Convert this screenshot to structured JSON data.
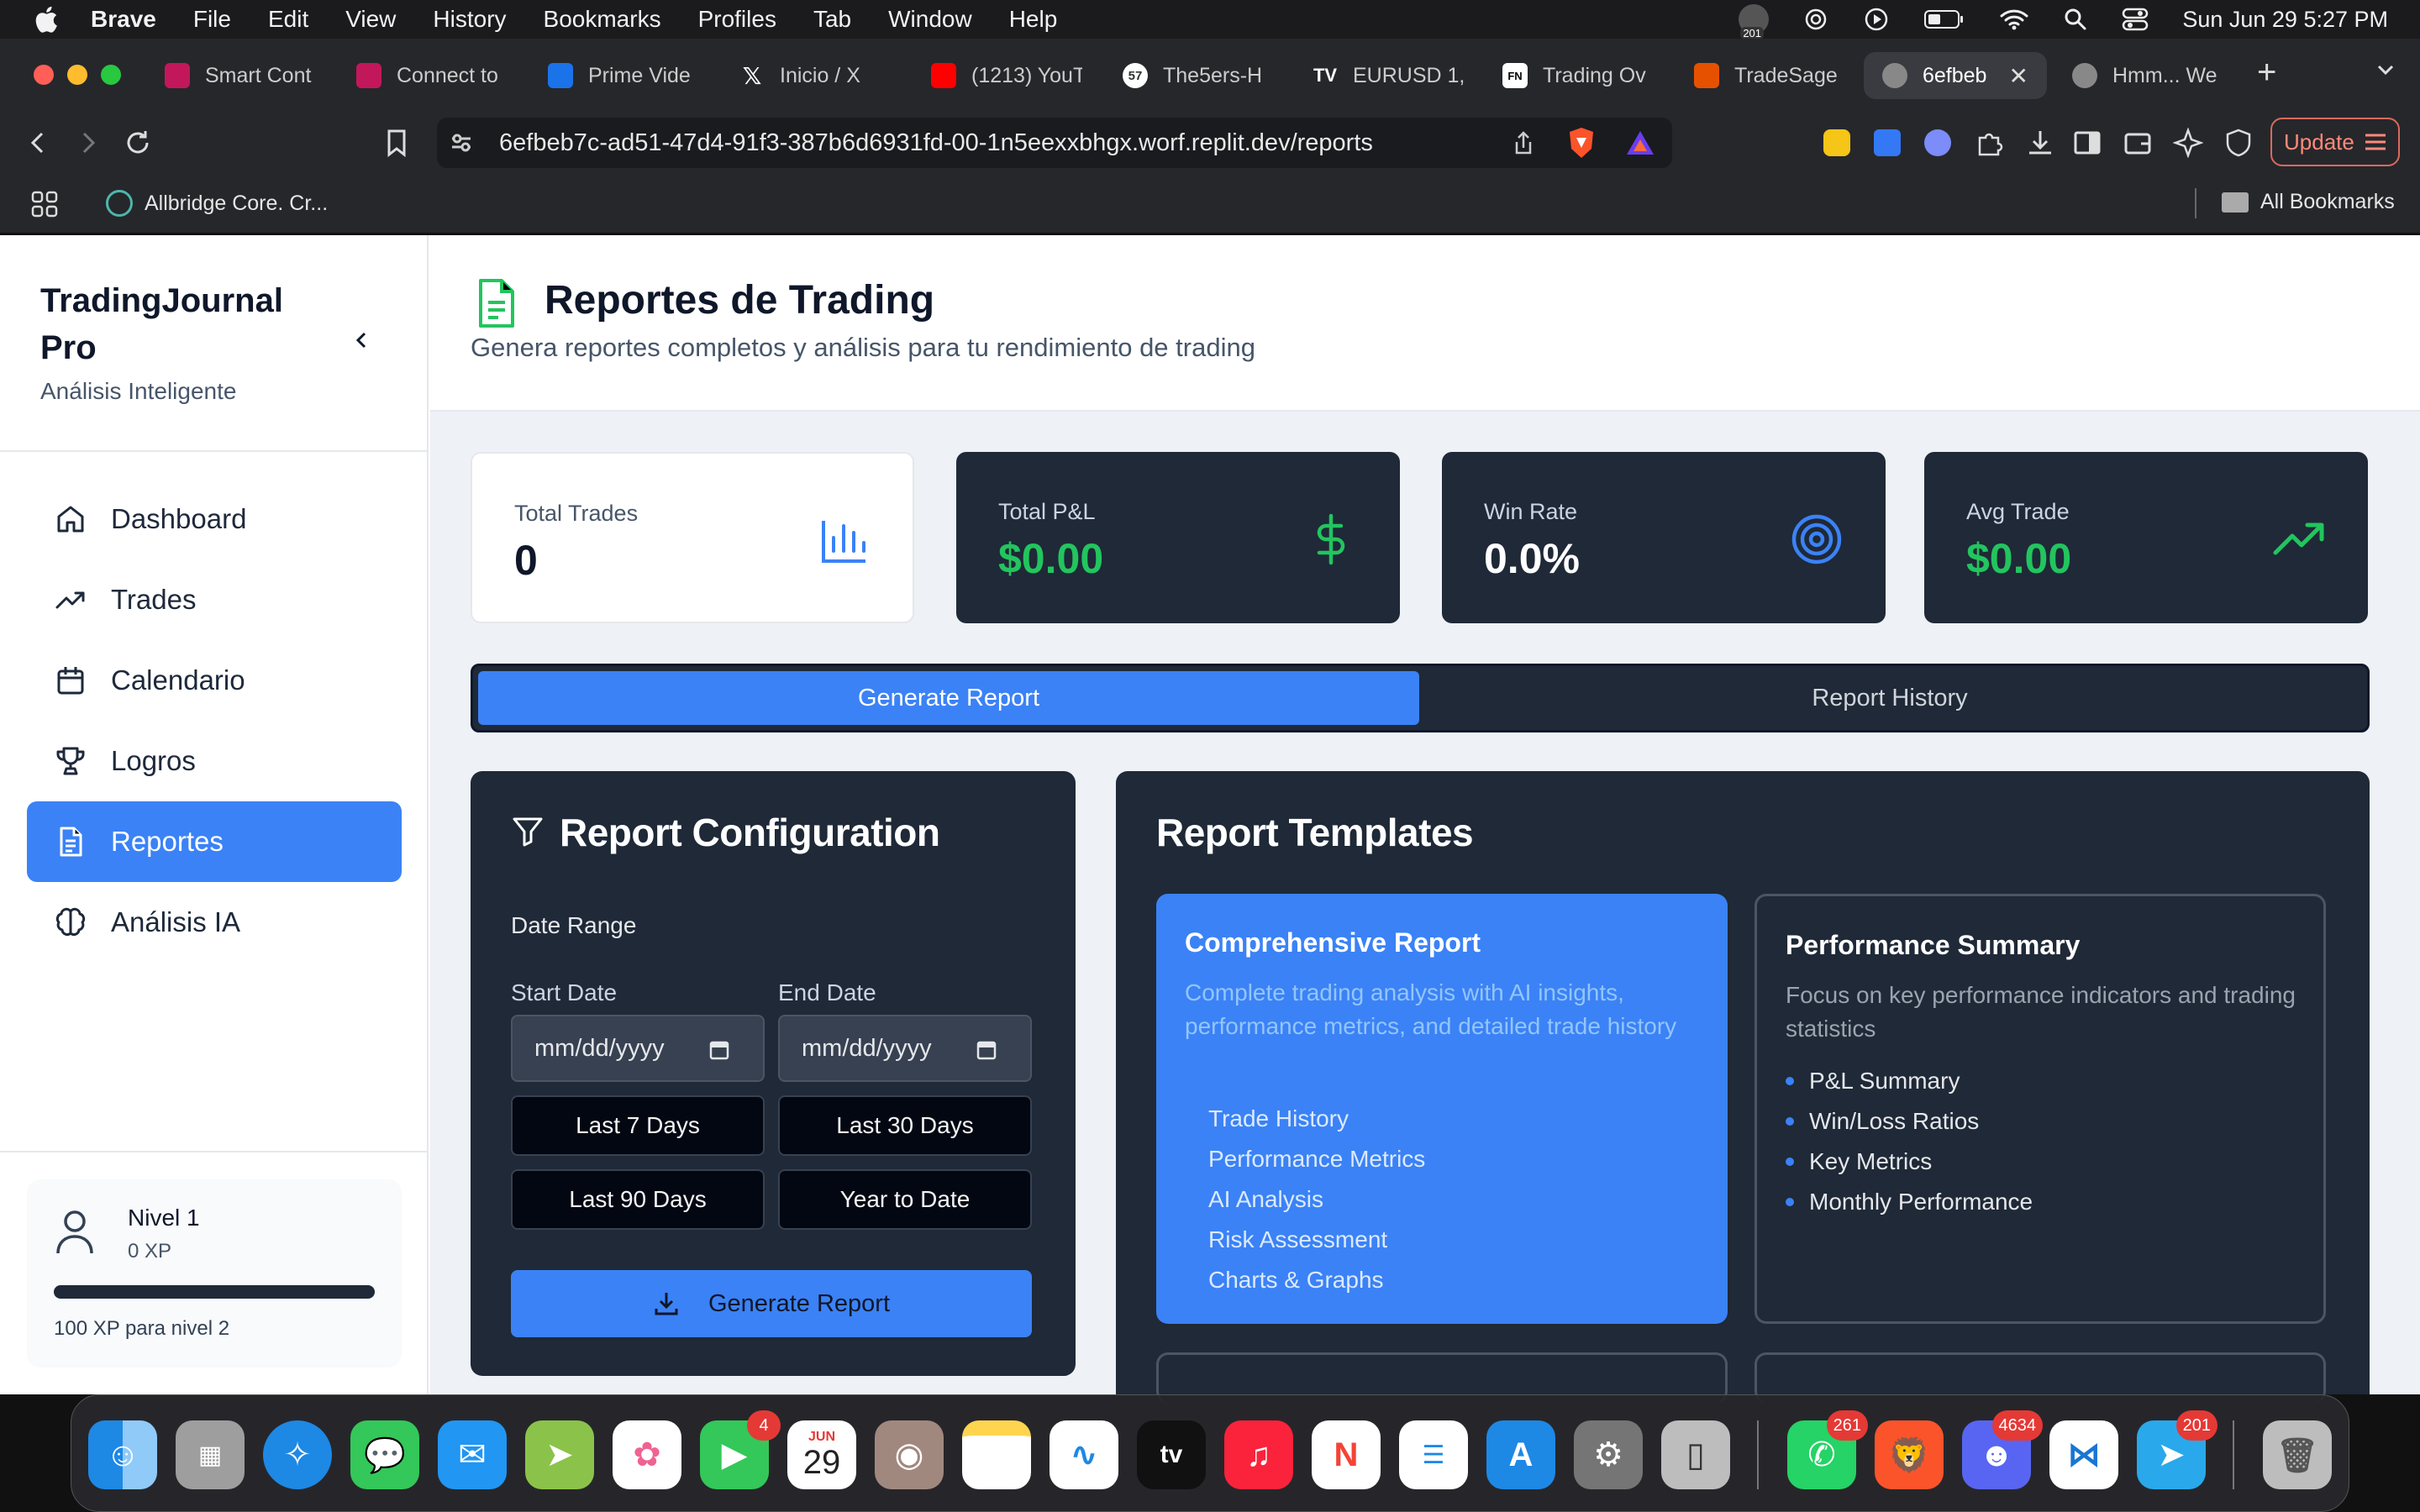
{
  "os_menubar": {
    "app_name": "Brave",
    "menus": [
      "File",
      "Edit",
      "View",
      "History",
      "Bookmarks",
      "Profiles",
      "Tab",
      "Window",
      "Help"
    ],
    "clock": "Sun Jun 29  5:27 PM",
    "status_badge": "201"
  },
  "browser": {
    "tabs": [
      {
        "label": "Smart Cont",
        "color": "#c2185b"
      },
      {
        "label": "Connect to",
        "color": "#c2185b"
      },
      {
        "label": "Prime Vide",
        "color": "#1a73e8"
      },
      {
        "label": "Inicio / X",
        "color": "#000000"
      },
      {
        "label": "(1213) YouT",
        "color": "#ff0000"
      },
      {
        "label": "The5ers-H",
        "color": "#ffffff"
      },
      {
        "label": "EURUSD 1,",
        "color": "#000000"
      },
      {
        "label": "Trading Ov",
        "color": "#ffffff"
      },
      {
        "label": "TradeSage",
        "color": "#e65100"
      },
      {
        "label": "6efbeb",
        "color": "#888888"
      },
      {
        "label": "Hmm... We",
        "color": "#888888"
      }
    ],
    "url": "6efbeb7c-ad51-47d4-91f3-387b6d6931fd-00-1n5eexxbhgx.worf.replit.dev/reports",
    "bookmark_item": "Allbridge Core. Cr...",
    "all_bookmarks": "All Bookmarks",
    "update_label": "Update"
  },
  "sidebar": {
    "title": "TradingJournal Pro",
    "subtitle": "Análisis Inteligente",
    "items": [
      {
        "label": "Dashboard",
        "icon": "home-icon"
      },
      {
        "label": "Trades",
        "icon": "trending-up-icon"
      },
      {
        "label": "Calendario",
        "icon": "calendar-icon"
      },
      {
        "label": "Logros",
        "icon": "trophy-icon"
      },
      {
        "label": "Reportes",
        "icon": "file-text-icon",
        "active": true
      },
      {
        "label": "Análisis IA",
        "icon": "brain-icon"
      }
    ],
    "level": {
      "title": "Nivel 1",
      "xp": "0 XP",
      "next": "100 XP para nivel 2",
      "progress": 0
    }
  },
  "header": {
    "title": "Reportes de Trading",
    "subtitle": "Genera reportes completos y análisis para tu rendimiento de trading"
  },
  "stats": [
    {
      "label": "Total Trades",
      "value": "0",
      "icon": "bar-chart-icon"
    },
    {
      "label": "Total P&L",
      "value": "$0.00",
      "icon": "dollar-icon"
    },
    {
      "label": "Win Rate",
      "value": "0.0%",
      "icon": "target-icon"
    },
    {
      "label": "Avg Trade",
      "value": "$0.00",
      "icon": "trending-up-icon"
    }
  ],
  "toggle": {
    "generate": "Generate Report",
    "history": "Report History"
  },
  "config": {
    "title": "Report Configuration",
    "date_range": "Date Range",
    "start_label": "Start Date",
    "end_label": "End Date",
    "start_placeholder": "mm/dd/yyyy",
    "end_placeholder": "mm/dd/yyyy",
    "quick": [
      "Last 7 Days",
      "Last 30 Days",
      "Last 90 Days",
      "Year to Date"
    ],
    "generate": "Generate Report"
  },
  "templates": {
    "title": "Report Templates",
    "items": [
      {
        "title": "Comprehensive Report",
        "desc": "Complete trading analysis with AI insights, performance metrics, and detailed trade history",
        "features": [
          "Trade History",
          "Performance Metrics",
          "AI Analysis",
          "Risk Assessment",
          "Charts & Graphs"
        ]
      },
      {
        "title": "Performance Summary",
        "desc": "Focus on key performance indicators and trading statistics",
        "features": [
          "P&L Summary",
          "Win/Loss Ratios",
          "Key Metrics",
          "Monthly Performance"
        ]
      }
    ]
  },
  "dock": {
    "calendar_month": "JUN",
    "calendar_day": "29",
    "badges": {
      "facetime": "4",
      "whatsapp": "261",
      "discord": "4634",
      "telegram": "201"
    }
  },
  "colors": {
    "accent": "#3b82f6",
    "positive": "#22c55e",
    "card": "#1f2937"
  }
}
